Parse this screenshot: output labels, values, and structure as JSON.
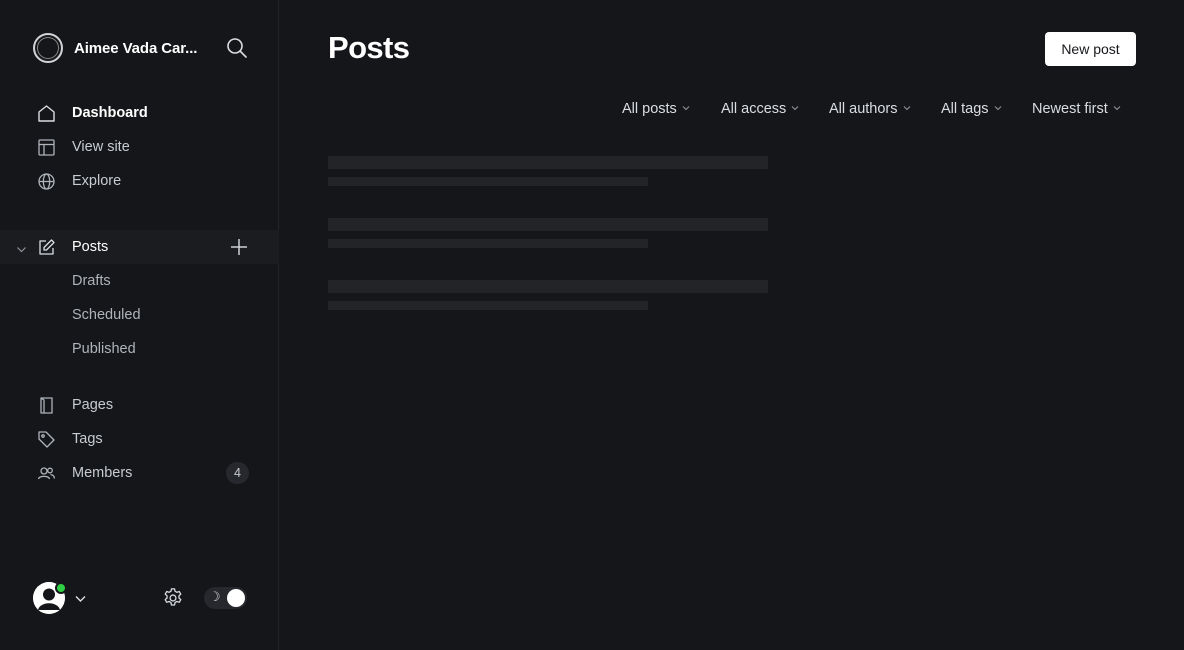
{
  "site": {
    "name": "Aimee Vada Car..."
  },
  "nav": {
    "dashboard": "Dashboard",
    "view_site": "View site",
    "explore": "Explore",
    "posts": "Posts",
    "drafts": "Drafts",
    "scheduled": "Scheduled",
    "published": "Published",
    "pages": "Pages",
    "tags": "Tags",
    "members": "Members",
    "members_count": "4"
  },
  "main": {
    "title": "Posts",
    "new_post_label": "New post",
    "filters": [
      "All posts",
      "All access",
      "All authors",
      "All tags",
      "Newest first"
    ]
  },
  "icons": {
    "search": "search-icon",
    "dashboard": "home-icon",
    "view_site": "layout-icon",
    "explore": "globe-icon",
    "posts": "edit-icon",
    "add_post": "plus-icon",
    "pages": "page-icon",
    "tags": "tag-icon",
    "members": "members-icon",
    "settings": "gear-icon",
    "theme": "moon-icon"
  },
  "colors": {
    "background": "#151619",
    "accent_button": "#ffffff",
    "online_status": "#30cf43"
  }
}
